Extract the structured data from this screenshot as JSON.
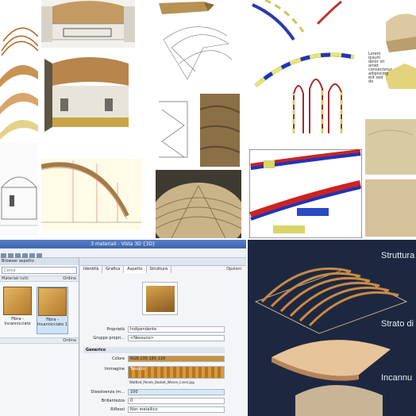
{
  "grid": {
    "tiles": [
      {
        "name": "vault-ribs-layers-icon"
      },
      {
        "name": "interior-room-render"
      },
      {
        "name": "beam-detail-render"
      },
      {
        "name": "vault-sketch"
      },
      {
        "name": "colored-arch-ribs"
      },
      {
        "name": "vault-volume-render"
      },
      {
        "name": "vault-section-drawing"
      },
      {
        "name": "arch-section-drawing"
      },
      {
        "name": "wood-photo"
      },
      {
        "name": "ribbed-dome-photo"
      },
      {
        "name": "beam-connection-render"
      },
      {
        "name": "plaster-texture-photo"
      },
      {
        "name": "room-section-drawing"
      }
    ],
    "vault_volume_note": "Lorem ipsum dolor sit amet consectetur adipiscing elit sed do"
  },
  "revit": {
    "title": "3 materiali - Vista 3D {3D}",
    "left_header": "Browser aspetto",
    "search_placeholder": "Cerca",
    "filter_label": "Materiali tutti",
    "order_label": "Ordina",
    "order_label_2": "Ordina",
    "thumb1_label": "Fibra - Incannicciato",
    "thumb2_label": "Fibra - Incannicciato 1",
    "tabs": [
      "Identità",
      "Grafica",
      "Aspetto",
      "Struttura"
    ],
    "active_tab": "Aspetto",
    "options_label": "Opzioni",
    "prop_label": "Proprietà",
    "prop_value": "Indipendente",
    "group_label": "Gruppo propri...",
    "group_value": "<Nessuno>",
    "section_label": "Generico",
    "color_label": "Colore",
    "color_value": "RGB 236 185 116",
    "image_label": "Immagine",
    "image_value": "Tessuto",
    "image_file": "Wattled_Panels_Basket_Woven_Linen.jpg",
    "dissolve_label": "Dissolvenza im...",
    "dissolve_value": "100",
    "brightness_label": "Brillantezza",
    "brightness_value": "0",
    "reflex_label": "Riflessi",
    "reflex_value": "Non metallico"
  },
  "layers": {
    "label1": "Struttura",
    "label2": "Strato di",
    "label3": "Incannu"
  }
}
